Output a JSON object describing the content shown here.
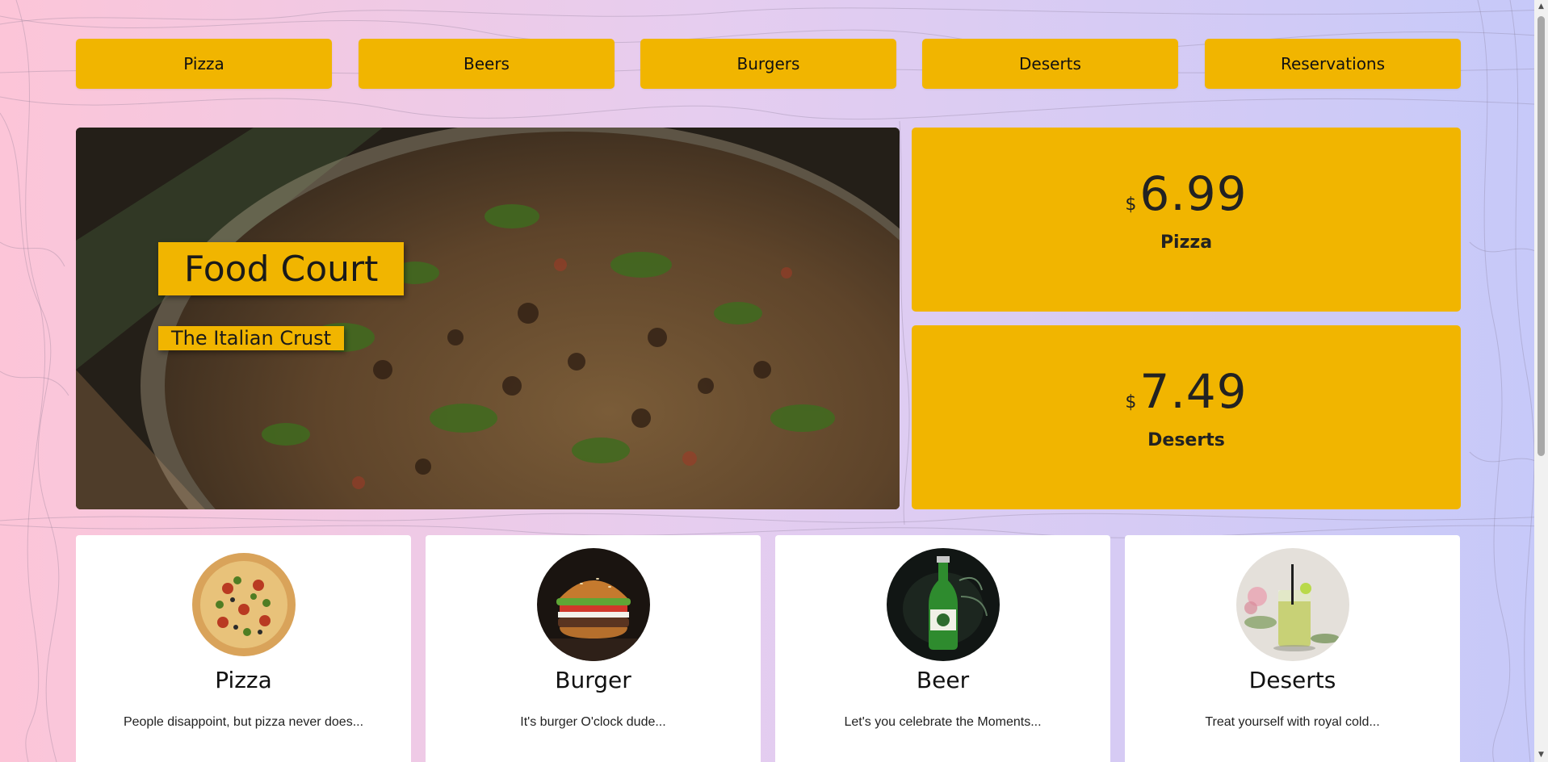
{
  "nav": {
    "items": [
      {
        "label": "Pizza"
      },
      {
        "label": "Beers"
      },
      {
        "label": "Burgers"
      },
      {
        "label": "Deserts"
      },
      {
        "label": "Reservations"
      }
    ]
  },
  "hero": {
    "title": "Food Court",
    "subtitle": "The Italian Crust"
  },
  "prices": [
    {
      "currency": "$",
      "value": "6.99",
      "label": "Pizza"
    },
    {
      "currency": "$",
      "value": "7.49",
      "label": "Deserts"
    }
  ],
  "cards": [
    {
      "title": "Pizza",
      "description": "People disappoint, but pizza never does..."
    },
    {
      "title": "Burger",
      "description": "It's burger O'clock dude..."
    },
    {
      "title": "Beer",
      "description": "Let's you celebrate the Moments..."
    },
    {
      "title": "Deserts",
      "description": "Treat yourself with royal cold..."
    }
  ],
  "colors": {
    "accent": "#f1b500",
    "background_left": "#fcc5d8",
    "background_right": "#c6c9f9",
    "card": "#ffffff"
  }
}
